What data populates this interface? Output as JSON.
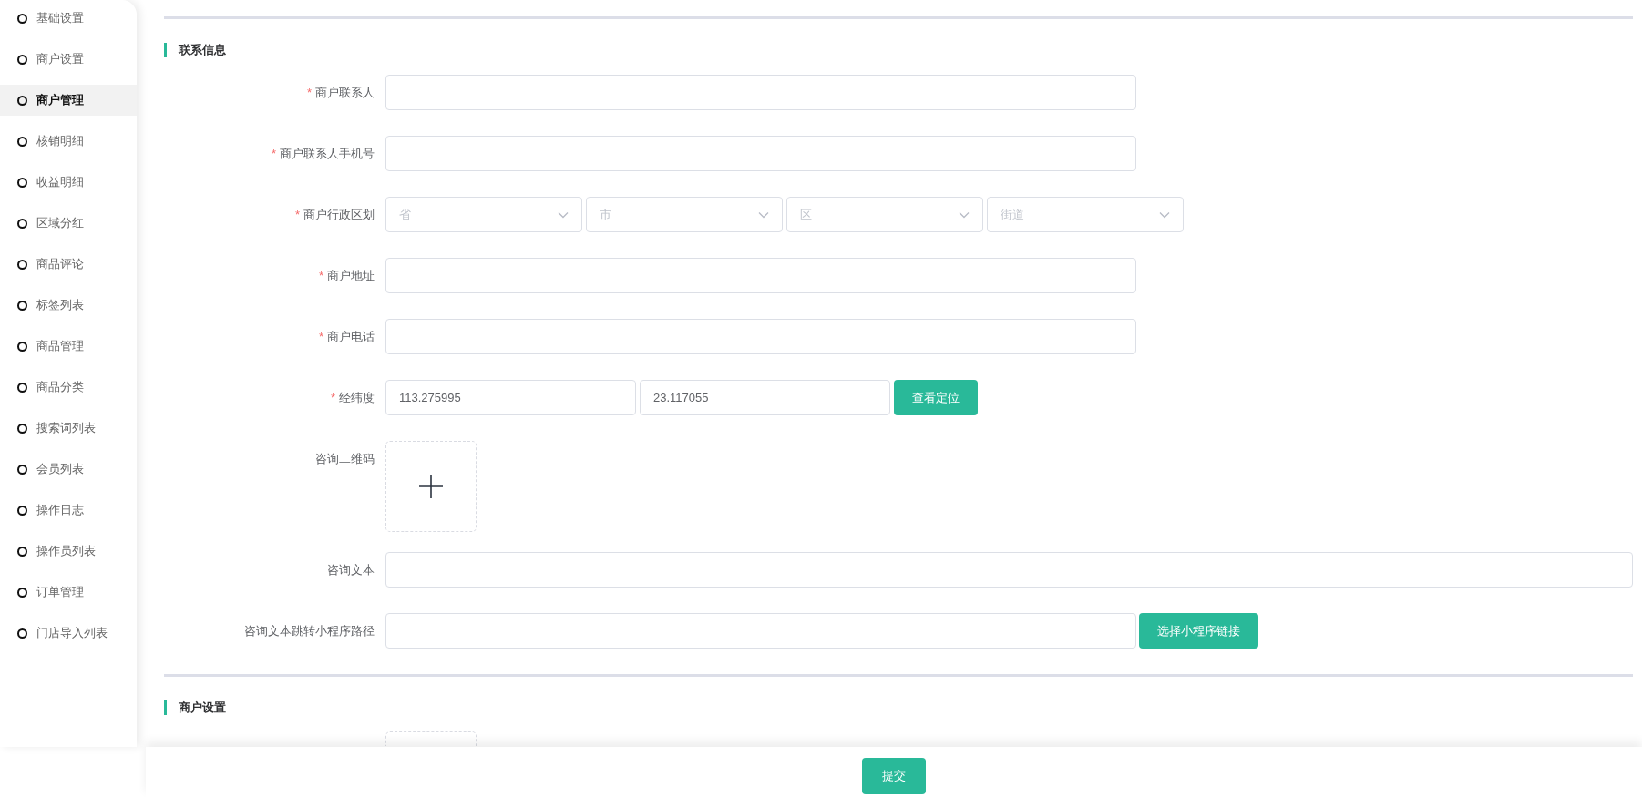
{
  "sidebar": {
    "items": [
      {
        "label": "基础设置",
        "selected": false
      },
      {
        "label": "商户设置",
        "selected": false
      },
      {
        "label": "商户管理",
        "selected": true
      },
      {
        "label": "核销明细",
        "selected": false
      },
      {
        "label": "收益明细",
        "selected": false
      },
      {
        "label": "区域分红",
        "selected": false
      },
      {
        "label": "商品评论",
        "selected": false
      },
      {
        "label": "标签列表",
        "selected": false
      },
      {
        "label": "商品管理",
        "selected": false
      },
      {
        "label": "商品分类",
        "selected": false
      },
      {
        "label": "搜索词列表",
        "selected": false
      },
      {
        "label": "会员列表",
        "selected": false
      },
      {
        "label": "操作日志",
        "selected": false
      },
      {
        "label": "操作员列表",
        "selected": false
      },
      {
        "label": "订单管理",
        "selected": false
      },
      {
        "label": "门店导入列表",
        "selected": false
      }
    ]
  },
  "sections": [
    {
      "title": "联系信息",
      "fields": [
        {
          "kind": "text",
          "required_mark": "*",
          "label": "商户联系人"
        },
        {
          "kind": "text",
          "required_mark": "*",
          "label": "商户联系人手机号"
        },
        {
          "kind": "selects",
          "required_mark": "*",
          "label": "商户行政区划",
          "options": [
            {
              "placeholder": "省"
            },
            {
              "placeholder": "市"
            },
            {
              "placeholder": "区"
            },
            {
              "placeholder": "街道"
            }
          ]
        },
        {
          "kind": "text",
          "required_mark": "*",
          "label": "商户地址"
        },
        {
          "kind": "text",
          "required_mark": "*",
          "label": "商户电话"
        },
        {
          "kind": "coords",
          "required_mark": "*",
          "label": "经纬度",
          "values": [
            "113.275995",
            "23.117055"
          ],
          "button": "查看定位"
        },
        {
          "kind": "upload",
          "label": "咨询二维码"
        },
        {
          "kind": "wide_text",
          "label": "咨询文本"
        },
        {
          "kind": "text_button",
          "label": "咨询文本跳转小程序路径",
          "button": "选择小程序链接"
        }
      ]
    },
    {
      "title": "商户设置",
      "fields": [
        {
          "kind": "upload_partial"
        }
      ]
    }
  ],
  "footer": {
    "submit": "提交"
  }
}
